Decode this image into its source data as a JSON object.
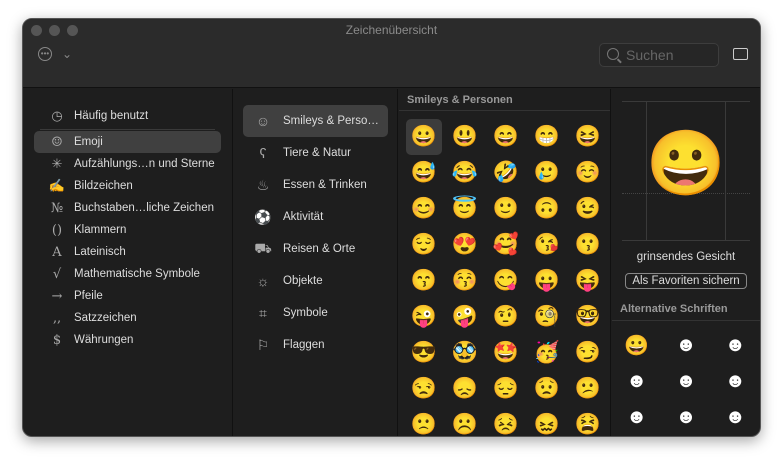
{
  "window": {
    "title": "Zeichenübersicht"
  },
  "search": {
    "placeholder": "Suchen"
  },
  "sidebar": {
    "items": [
      {
        "label": "Häufig benutzt",
        "icon": "clock-icon",
        "glyph": "◷"
      },
      {
        "label": "Emoji",
        "icon": "smiley-icon",
        "glyph": "☺"
      },
      {
        "label": "Aufzählungs…n und Sterne",
        "icon": "asterisk-icon",
        "glyph": "✳"
      },
      {
        "label": "Bildzeichen",
        "icon": "pictograph-icon",
        "glyph": "✍"
      },
      {
        "label": "Buchstaben…liche Zeichen",
        "icon": "numero-icon",
        "glyph": "№"
      },
      {
        "label": "Klammern",
        "icon": "parentheses-icon",
        "glyph": "()"
      },
      {
        "label": "Lateinisch",
        "icon": "latin-a-icon",
        "glyph": "A"
      },
      {
        "label": "Mathematische Symbole",
        "icon": "square-root-icon",
        "glyph": "√"
      },
      {
        "label": "Pfeile",
        "icon": "arrow-icon",
        "glyph": "→"
      },
      {
        "label": "Satzzeichen",
        "icon": "punctuation-icon",
        "glyph": "‚,"
      },
      {
        "label": "Währungen",
        "icon": "dollar-icon",
        "glyph": "$"
      }
    ]
  },
  "categories": [
    {
      "label": "Smileys & Perso…",
      "icon": "smiley-icon",
      "glyph": "☺"
    },
    {
      "label": "Tiere & Natur",
      "icon": "bear-icon",
      "glyph": "ʕ"
    },
    {
      "label": "Essen & Trinken",
      "icon": "food-icon",
      "glyph": "♨"
    },
    {
      "label": "Aktivität",
      "icon": "soccer-ball-icon",
      "glyph": "⚽"
    },
    {
      "label": "Reisen & Orte",
      "icon": "car-icon",
      "glyph": "⛟"
    },
    {
      "label": "Objekte",
      "icon": "lightbulb-icon",
      "glyph": "☼"
    },
    {
      "label": "Symbole",
      "icon": "symbols-icon",
      "glyph": "⌗"
    },
    {
      "label": "Flaggen",
      "icon": "flag-icon",
      "glyph": "⚐"
    }
  ],
  "emoji_section": {
    "title": "Smileys & Personen",
    "emojis": [
      "😀",
      "😃",
      "😄",
      "😁",
      "😆",
      "😅",
      "😂",
      "🤣",
      "🥲",
      "☺️",
      "😊",
      "😇",
      "🙂",
      "🙃",
      "😉",
      "😌",
      "😍",
      "🥰",
      "😘",
      "😗",
      "😙",
      "😚",
      "😋",
      "😛",
      "😝",
      "😜",
      "🤪",
      "🤨",
      "🧐",
      "🤓",
      "😎",
      "🥸",
      "🤩",
      "🥳",
      "😏",
      "😒",
      "😞",
      "😔",
      "😟",
      "😕",
      "🙁",
      "☹️",
      "😣",
      "😖",
      "😫"
    ]
  },
  "detail": {
    "emoji": "😀",
    "name": "grinsendes Gesicht",
    "fav_label": "Als Favoriten sichern",
    "alt_title": "Alternative Schriften",
    "alts": [
      "😀",
      "☻",
      "☻",
      "☻",
      "☻",
      "☻",
      "☻",
      "☻",
      "☻",
      "☻",
      "☻",
      "☻"
    ]
  }
}
